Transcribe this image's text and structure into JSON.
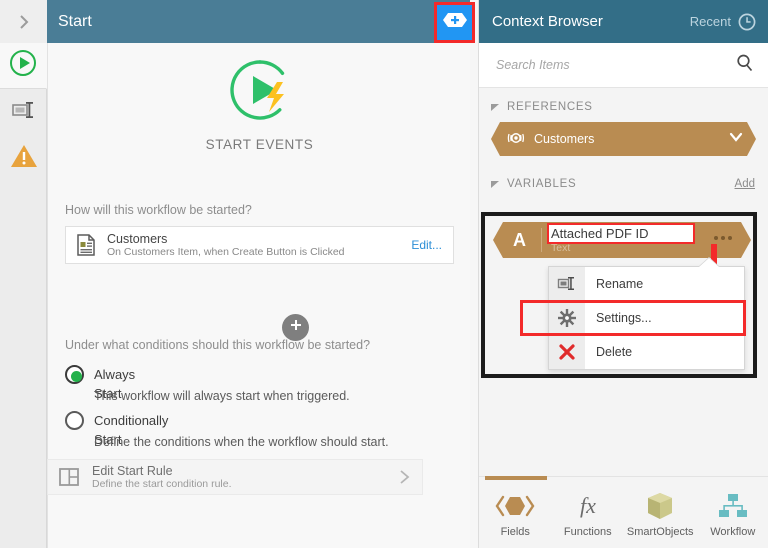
{
  "main": {
    "header": {
      "title": "Start",
      "collapse_icon": "chevron-right-icon",
      "add_button_icon": "hexagon-plus-icon"
    },
    "rail": [
      {
        "icon": "play-circle-icon",
        "name": "start-events",
        "active": true
      },
      {
        "icon": "rename-icon",
        "name": "rename",
        "active": false
      },
      {
        "icon": "warning-triangle-icon",
        "name": "warnings",
        "active": false
      }
    ],
    "logo": {
      "label": "START EVENTS",
      "icon": "play-lightning-icon"
    },
    "question_1": "How will this workflow be started?",
    "trigger": {
      "icon": "form-item-icon",
      "title": "Customers",
      "subtitle": "On Customers Item, when Create Button is Clicked",
      "edit_label": "Edit..."
    },
    "add_trigger_icon": "plus-circle-icon",
    "delete_trigger_icon": "trash-icon",
    "question_2": "Under what conditions should this workflow be started?",
    "options": [
      {
        "label": "Always Start",
        "description": "This workflow will always start when triggered.",
        "selected": true
      },
      {
        "label": "Conditionally Start",
        "description": "Define the conditions when the workflow should start.",
        "selected": false
      }
    ],
    "edit_start_rule": {
      "icon": "layout-panel-icon",
      "title": "Edit Start Rule",
      "subtitle": "Define the start condition rule.",
      "chevron_icon": "chevron-right-icon"
    }
  },
  "context_browser": {
    "title": "Context Browser",
    "recent_label": "Recent",
    "recent_icon": "clock-icon",
    "search": {
      "placeholder": "Search Items",
      "value": "",
      "icon": "search-icon"
    },
    "references": {
      "section_title": "REFERENCES",
      "caret_icon": "caret-down-icon",
      "items": [
        {
          "label": "Customers",
          "icon": "smartobject-icon",
          "chevron": "chevron-down-icon"
        }
      ]
    },
    "variables": {
      "section_title": "VARIABLES",
      "caret_icon": "caret-down-icon",
      "add_label": "Add",
      "item": {
        "letter": "A",
        "name": "Attached PDF ID",
        "type": "Text",
        "menu_icon": "ellipsis-icon"
      },
      "menu": [
        {
          "label": "Rename",
          "icon": "rename-icon"
        },
        {
          "label": "Settings...",
          "icon": "gear-icon"
        },
        {
          "label": "Delete",
          "icon": "red-x-icon"
        }
      ]
    },
    "tabs": [
      {
        "label": "Fields",
        "icon": "fields-hexagon-icon",
        "active": true
      },
      {
        "label": "Functions",
        "icon": "fx-icon",
        "active": false
      },
      {
        "label": "SmartObjects",
        "icon": "cube-icon",
        "active": false
      },
      {
        "label": "Workflow",
        "icon": "workflow-tree-icon",
        "active": false
      }
    ]
  },
  "colors": {
    "header_blue": "#4a7d96",
    "panel_header_blue": "#336e87",
    "accent_tan": "#b98c52",
    "highlight_red": "#f32a2a",
    "add_button_blue": "#2196f3",
    "green": "#23b24b",
    "link_blue": "#2b8ed6"
  }
}
